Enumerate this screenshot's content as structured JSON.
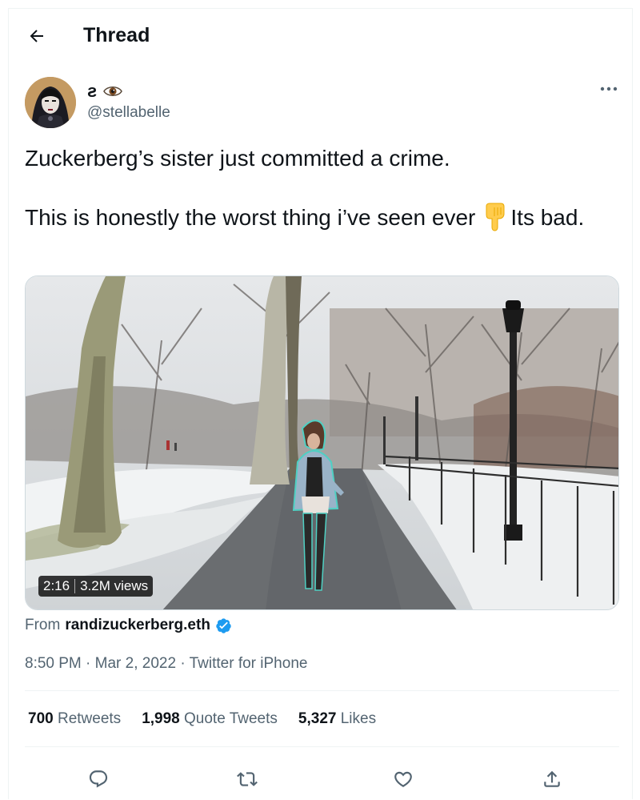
{
  "header": {
    "title": "Thread"
  },
  "author": {
    "display_name": "ƨ",
    "handle": "@stellabelle"
  },
  "tweet": {
    "line1": "Zuckerberg’s sister just committed a crime.",
    "line2_start": "This is honestly the worst thing i’ve seen ever",
    "line2_end": "Its bad."
  },
  "video": {
    "duration": "2:16",
    "views": "3.2M views"
  },
  "from": {
    "prefix": "From",
    "source": "randizuckerberg.eth"
  },
  "meta": {
    "time": "8:50 PM",
    "separator1": " · ",
    "date": "Mar 2, 2022",
    "separator2": " · ",
    "app": "Twitter for iPhone"
  },
  "stats": {
    "retweets_count": "700",
    "retweets_label": "Retweets",
    "quotes_count": "1,998",
    "quotes_label": "Quote Tweets",
    "likes_count": "5,327",
    "likes_label": "Likes"
  },
  "icons": {
    "back": "arrow-left-icon",
    "more": "more-horizontal-icon",
    "eye": "eye-icon",
    "finger": "backhand-index-pointing-down-icon",
    "verified": "verified-badge-icon",
    "reply": "reply-icon",
    "retweet": "retweet-icon",
    "like": "heart-icon",
    "share": "share-icon"
  },
  "colors": {
    "text": "#0f1419",
    "secondary": "#536471",
    "verified_blue": "#1d9bf0",
    "divider": "#eff3f4"
  }
}
